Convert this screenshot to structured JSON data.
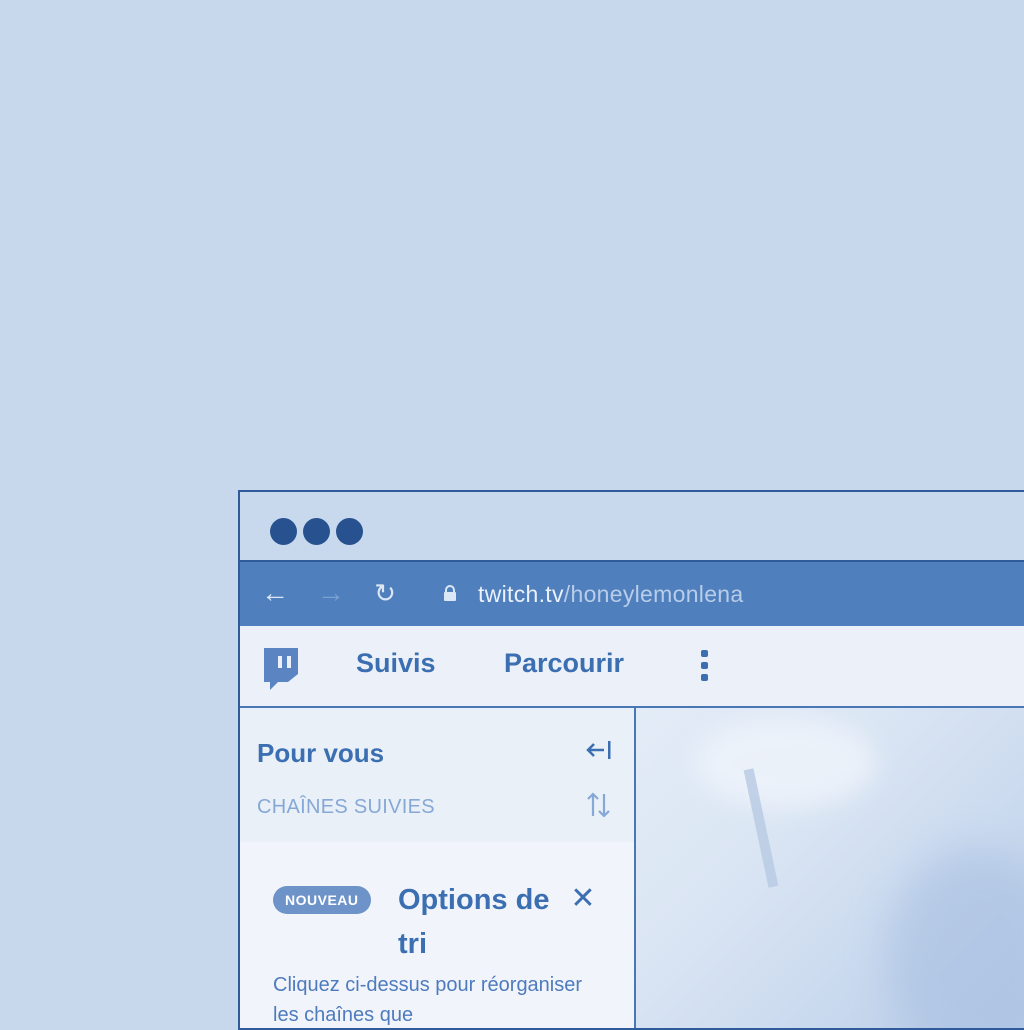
{
  "browser": {
    "url_domain": "twitch.tv",
    "url_path": "/honeylemonlena"
  },
  "topnav": {
    "following_label": "Suivis",
    "browse_label": "Parcourir"
  },
  "sidebar": {
    "title": "Pour vous",
    "section_label": "CHAÎNES SUIVIES",
    "promo": {
      "badge": "NOUVEAU",
      "title": "Options de tri",
      "text": "Cliquez ci-dessus pour réorganiser les chaînes que"
    }
  },
  "icons": {
    "back": "arrow-left-icon",
    "forward": "arrow-right-icon",
    "reload": "reload-icon",
    "lock": "lock-icon",
    "logo": "twitch-logo-icon",
    "more": "more-vertical-icon",
    "collapse": "collapse-sidebar-icon",
    "sort": "sort-icon",
    "close": "close-icon"
  },
  "colors": {
    "background": "#c8d8ec",
    "accent": "#3b6fb1",
    "addressbar": "#4f7fbc",
    "window_controls": "#27528f"
  }
}
